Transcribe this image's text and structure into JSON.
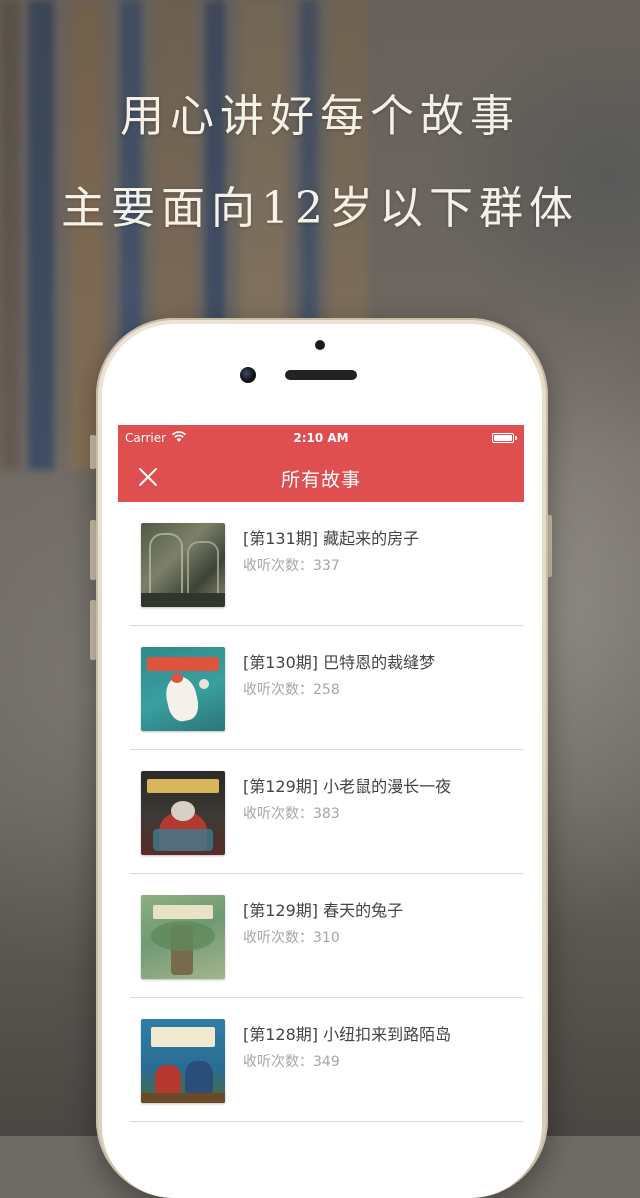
{
  "headline": {
    "line1": "用心讲好每个故事",
    "line2": "主要面向12岁以下群体"
  },
  "status_bar": {
    "carrier": "Carrier",
    "time": "2:10 AM"
  },
  "nav": {
    "title": "所有故事",
    "close_icon": "close-icon"
  },
  "colors": {
    "accent": "#e04f4f",
    "title_text": "#444444",
    "meta_text": "#a6a6a6"
  },
  "stories": [
    {
      "title": "[第131期] 藏起来的房子",
      "listens": "收听次数：337"
    },
    {
      "title": "[第130期] 巴特恩的裁缝梦",
      "listens": "收听次数：258"
    },
    {
      "title": "[第129期] 小老鼠的漫长一夜",
      "listens": "收听次数：383"
    },
    {
      "title": "[第129期] 春天的兔子",
      "listens": "收听次数：310"
    },
    {
      "title": "[第128期] 小纽扣来到路陌岛",
      "listens": "收听次数：349"
    }
  ]
}
